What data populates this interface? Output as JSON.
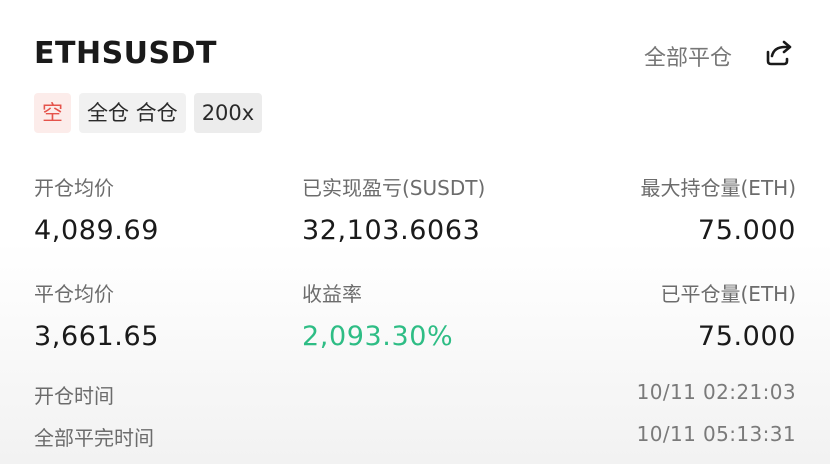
{
  "header": {
    "symbol": "ETHSUSDT",
    "close_all_label": "全部平仓",
    "share_icon": "share-icon"
  },
  "tags": {
    "side": "空",
    "margin_mode": "全仓 合仓",
    "leverage": "200x"
  },
  "stats_row1": {
    "open_avg_price": {
      "label": "开仓均价",
      "value": "4,089.69"
    },
    "realized_pnl": {
      "label": "已实现盈亏(SUSDT)",
      "value": "32,103.6063"
    },
    "max_position": {
      "label": "最大持仓量(ETH)",
      "value": "75.000"
    }
  },
  "stats_row2": {
    "close_avg_price": {
      "label": "平仓均价",
      "value": "3,661.65"
    },
    "roi": {
      "label": "收益率",
      "value": "2,093.30%"
    },
    "closed_position": {
      "label": "已平仓量(ETH)",
      "value": "75.000"
    }
  },
  "times": {
    "open_time": {
      "label": "开仓时间",
      "value": "10/11 02:21:03"
    },
    "closed_time": {
      "label": "全部平完时间",
      "value": "10/11 05:13:31"
    }
  },
  "colors": {
    "profit_green": "#2ebd85",
    "short_red": "#e5534b"
  }
}
